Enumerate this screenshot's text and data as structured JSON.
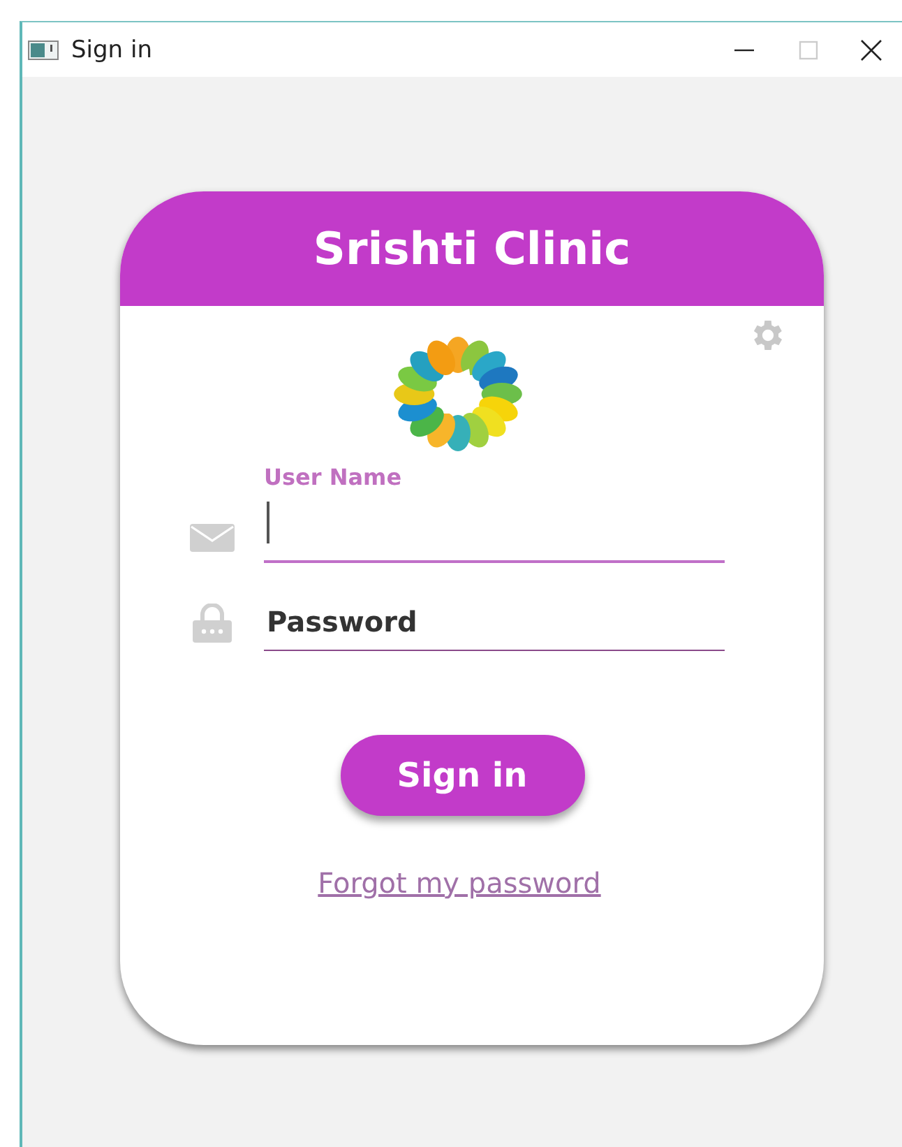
{
  "window": {
    "title": "Sign in"
  },
  "card": {
    "title": "Srishti Clinic"
  },
  "fields": [
    {
      "kind": "email",
      "label": "User Name",
      "focused": true
    },
    {
      "kind": "password",
      "placeholder": "Password",
      "focused": false
    }
  ],
  "button": "Sign in",
  "link": "Forgot my password"
}
